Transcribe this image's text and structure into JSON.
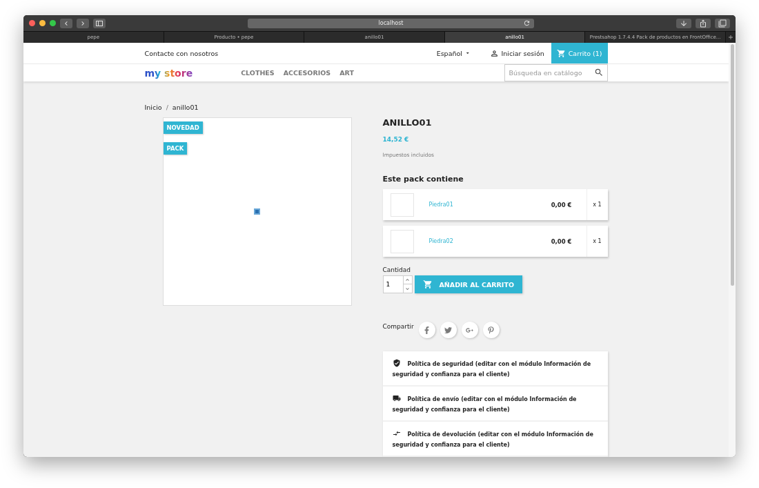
{
  "browser": {
    "url": "localhost",
    "tabs": [
      {
        "label": "pepe",
        "selected": false
      },
      {
        "label": "Producto • pepe",
        "selected": false
      },
      {
        "label": "anillo01",
        "selected": false
      },
      {
        "label": "anillo01",
        "selected": true
      },
      {
        "label": "Prestsahop 1.7.4.4 Pack de productos en FrontOffice...",
        "selected": false
      }
    ]
  },
  "header": {
    "contact": "Contacte con nosotros",
    "language": "Español",
    "login": "Iniciar sesión",
    "cart": "Carrito (1)",
    "logo": "my store",
    "nav": [
      "CLOTHES",
      "ACCESORIOS",
      "ART"
    ],
    "search": {
      "placeholder": "Búsqueda en catálogo"
    }
  },
  "breadcrumb": {
    "separator": "/",
    "items": [
      "Inicio",
      "anillo01"
    ]
  },
  "product": {
    "flags": [
      "NOVEDAD",
      "PACK"
    ],
    "title": "ANILLO01",
    "price": "14,52 €",
    "tax_note": "Impuestos incluidos",
    "pack_title": "Este pack contiene",
    "pack_items": [
      {
        "name": "Piedra01",
        "price": "0,00 €",
        "qty": "x 1"
      },
      {
        "name": "Piedra02",
        "price": "0,00 €",
        "qty": "x 1"
      }
    ],
    "quantity_label": "Cantidad",
    "quantity": "1",
    "add_button": "AÑADIR AL CARRITO",
    "share_label": "Compartir",
    "share": [
      {
        "kind": "facebook"
      },
      {
        "kind": "twitter"
      },
      {
        "kind": "googleplus"
      },
      {
        "kind": "pinterest"
      }
    ],
    "reassurance": [
      {
        "kind": "security",
        "text": "Política de seguridad (editar con el módulo Información de seguridad y confianza para el cliente)"
      },
      {
        "kind": "shipping",
        "text": "Política de envío (editar con el módulo Información de seguridad y confianza para el cliente)"
      },
      {
        "kind": "returns",
        "text": "Política de devolución (editar con el módulo Información de seguridad y confianza para el cliente)"
      }
    ]
  }
}
